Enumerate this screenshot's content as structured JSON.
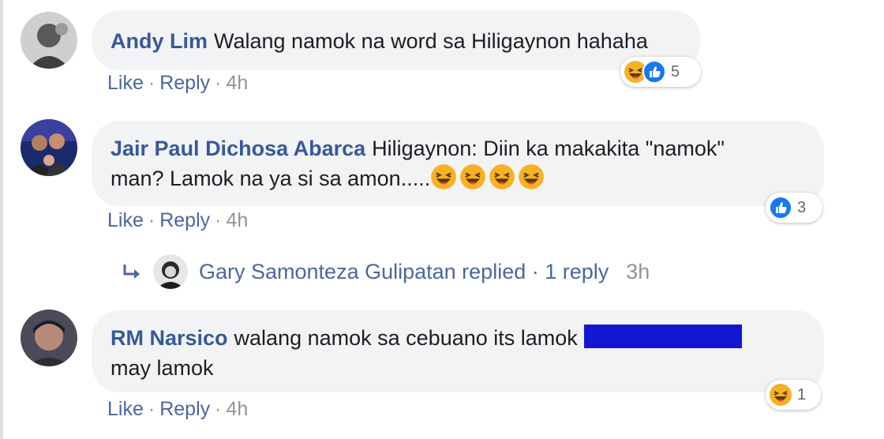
{
  "colors": {
    "bubble": "#f2f3f5",
    "author": "#385898",
    "link": "#4b67a1",
    "meta": "#90949c",
    "redaction": "#1515d4",
    "like_blue": "#1877f2",
    "haha_yellow": "#f7b125"
  },
  "comments": [
    {
      "author": "Andy Lim",
      "text": "Walang namok na word sa Hiligaynon hahaha",
      "actions": {
        "like": "Like",
        "reply": "Reply",
        "time": "4h"
      },
      "reactions": {
        "icons": [
          "haha-icon",
          "like-icon"
        ],
        "count": "5"
      }
    },
    {
      "author": "Jair Paul Dichosa Abarca",
      "text": "Hiligaynon: Diin ka makakita \"namok\" man? Lamok na ya si sa amon.....",
      "text_line1": "Hiligaynon: Diin ka makakita \"namok\"",
      "text_line2": "man? Lamok na ya si sa amon.....",
      "inline_emoji": [
        "haha-icon",
        "haha-icon",
        "haha-icon",
        "haha-icon"
      ],
      "actions": {
        "like": "Like",
        "reply": "Reply",
        "time": "4h"
      },
      "reactions": {
        "icons": [
          "like-icon"
        ],
        "count": "3"
      },
      "replies_summary": {
        "text": "Gary Samonteza Gulipatan replied · 1 reply",
        "time": "3h"
      }
    },
    {
      "author": "RM Narsico",
      "text_line1": "walang namok sa cebuano its lamok",
      "text_line2": "may lamok",
      "actions": {
        "like": "Like",
        "reply": "Reply",
        "time": "4h"
      },
      "reactions": {
        "icons": [
          "haha-icon"
        ],
        "count": "1"
      }
    }
  ],
  "separator": "·"
}
